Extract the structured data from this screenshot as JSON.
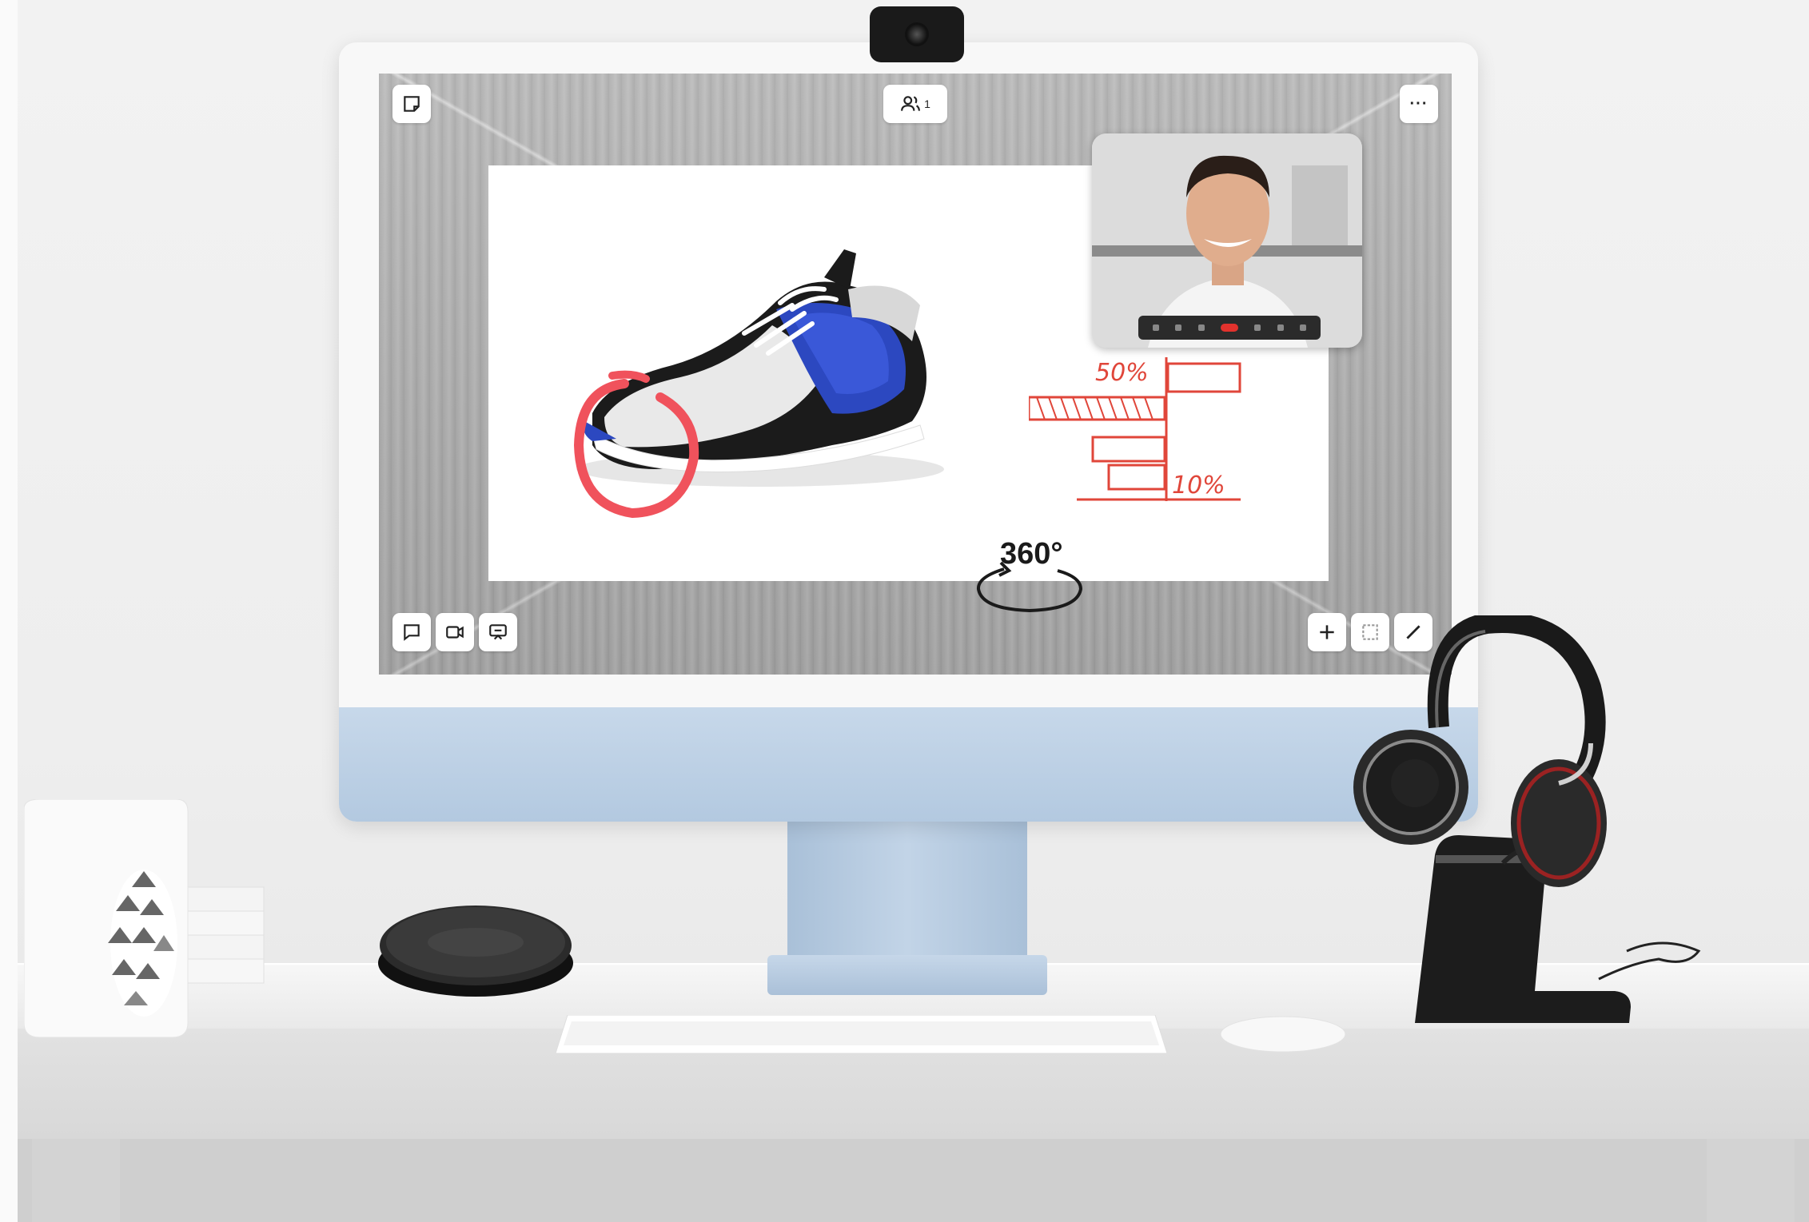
{
  "topbar": {
    "participants_count": "1",
    "more_menu_label": "···"
  },
  "board": {
    "rotate_label": "360°",
    "chart_annotation_top": "50%",
    "chart_annotation_bottom": "10%"
  },
  "icons": {
    "top_left": "sticky-note-icon",
    "top_center": "participants-icon",
    "top_right": "more-icon",
    "bottom_left": [
      "chat-icon",
      "video-camera-icon",
      "screen-share-icon"
    ],
    "bottom_right": [
      "plus-icon",
      "select-frame-icon",
      "pen-icon"
    ]
  },
  "colors": {
    "annotation_red": "#e0463a",
    "hangup_red": "#e2322d",
    "monitor_blue": "#b8cde3",
    "shoe_blue": "#2c48c0"
  }
}
